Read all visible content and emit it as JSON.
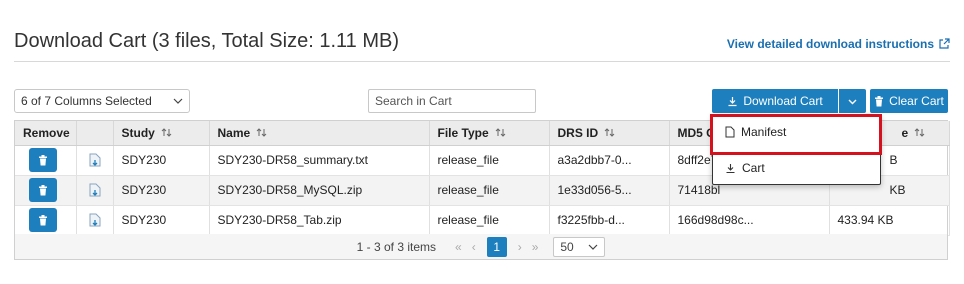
{
  "header": {
    "title": "Download Cart (3 files, Total Size: 1.11 MB)",
    "instructions_link": "View detailed download instructions"
  },
  "toolbar": {
    "columns_selected": "6 of 7 Columns Selected",
    "search_placeholder": "Search in Cart",
    "download_label": "Download Cart",
    "clear_label": "Clear Cart"
  },
  "dropdown": {
    "items": [
      {
        "label": "Manifest",
        "icon": "file-icon"
      },
      {
        "label": "Cart",
        "icon": "download-icon"
      }
    ]
  },
  "table": {
    "columns": [
      "Remove",
      "",
      "Study",
      "Name",
      "File Type",
      "DRS ID",
      "MD5 Cl",
      "e"
    ],
    "rows": [
      {
        "study": "SDY230",
        "name": "SDY230-DR58_summary.txt",
        "file_type": "release_file",
        "drs_id": "a3a2dbb7-0...",
        "md5": "8dff2e7",
        "size": "B"
      },
      {
        "study": "SDY230",
        "name": "SDY230-DR58_MySQL.zip",
        "file_type": "release_file",
        "drs_id": "1e33d056-5...",
        "md5": "71418bl",
        "size": "KB"
      },
      {
        "study": "SDY230",
        "name": "SDY230-DR58_Tab.zip",
        "file_type": "release_file",
        "drs_id": "f3225fbb-d...",
        "md5": "166d98d98c...",
        "size": "433.94 KB"
      }
    ]
  },
  "pager": {
    "items_label": "1 - 3 of 3 items",
    "first": "«",
    "prev": "‹",
    "current_page": "1",
    "next": "›",
    "last": "»",
    "page_size": "50"
  },
  "colors": {
    "accent": "#1d7fbd",
    "highlight": "#d6111e",
    "link": "#1a6fb0"
  }
}
